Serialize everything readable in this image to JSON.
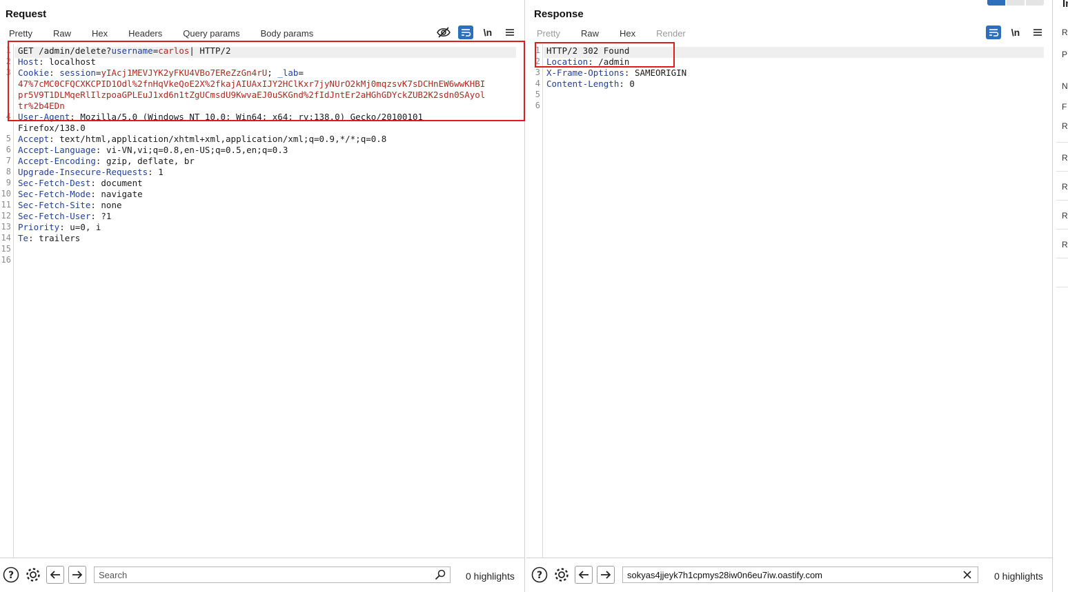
{
  "request": {
    "title": "Request",
    "tabs": [
      {
        "label": "Pretty",
        "active": true
      },
      {
        "label": "Raw"
      },
      {
        "label": "Hex"
      },
      {
        "label": "Headers"
      },
      {
        "label": "Query params"
      },
      {
        "label": "Body params"
      }
    ],
    "toolbar": {
      "newline_label": "\\n"
    },
    "lines": [
      {
        "n": "1",
        "seg": [
          [
            "GET /admin/delete?",
            ""
          ],
          [
            "username",
            "blue"
          ],
          [
            "=",
            ""
          ],
          [
            "carlos",
            "red"
          ],
          [
            "| HTTP/2",
            ""
          ]
        ]
      },
      {
        "n": "2",
        "seg": [
          [
            "Host",
            "blue"
          ],
          [
            ": localhost",
            ""
          ]
        ]
      },
      {
        "n": "3",
        "seg": [
          [
            "Cookie",
            "blue"
          ],
          [
            ": ",
            ""
          ],
          [
            "session",
            "blue"
          ],
          [
            "=",
            ""
          ],
          [
            "yIAcj1MEVJYK2yFKU4VBo7EReZzGn4rU",
            "red"
          ],
          [
            "; ",
            ""
          ],
          [
            "_lab",
            "blue"
          ],
          [
            "=",
            ""
          ]
        ]
      },
      {
        "n": "",
        "seg": [
          [
            "47%7cMC0CFQCXKCPID1Odl%2fnHqVkeQoE2X%2fkajAIUAxIJY2HClKxr7jyNUrO2kMj0mqzsvK7sDCHnEW6wwKHBI",
            "red"
          ]
        ]
      },
      {
        "n": "",
        "seg": [
          [
            "pr5V9T1DLMqeRlIlzpoaGPLEuJ1xd6n1tZgUCmsdU9KwvaEJ0uSKGnd%2fIdJntEr2aHGhGDYckZUB2K2sdn0SAyol",
            "red"
          ]
        ]
      },
      {
        "n": "",
        "seg": [
          [
            "tr%2b4EDn",
            "red"
          ]
        ]
      },
      {
        "n": "4",
        "seg": [
          [
            "User-Agent",
            "blue"
          ],
          [
            ": Mozilla/5.0 (Windows NT 10.0; Win64; x64; rv:138.0) Gecko/20100101",
            ""
          ]
        ]
      },
      {
        "n": "",
        "seg": [
          [
            "Firefox/138.0",
            ""
          ]
        ]
      },
      {
        "n": "5",
        "seg": [
          [
            "Accept",
            "blue"
          ],
          [
            ": text/html,application/xhtml+xml,application/xml;q=0.9,*/*;q=0.8",
            ""
          ]
        ]
      },
      {
        "n": "6",
        "seg": [
          [
            "Accept-Language",
            "blue"
          ],
          [
            ": vi-VN,vi;q=0.8,en-US;q=0.5,en;q=0.3",
            ""
          ]
        ]
      },
      {
        "n": "7",
        "seg": [
          [
            "Accept-Encoding",
            "blue"
          ],
          [
            ": gzip, deflate, br",
            ""
          ]
        ]
      },
      {
        "n": "8",
        "seg": [
          [
            "Upgrade-Insecure-Requests",
            "blue"
          ],
          [
            ": 1",
            ""
          ]
        ]
      },
      {
        "n": "9",
        "seg": [
          [
            "Sec-Fetch-Dest",
            "blue"
          ],
          [
            ": document",
            ""
          ]
        ]
      },
      {
        "n": "10",
        "seg": [
          [
            "Sec-Fetch-Mode",
            "blue"
          ],
          [
            ": navigate",
            ""
          ]
        ]
      },
      {
        "n": "11",
        "seg": [
          [
            "Sec-Fetch-Site",
            "blue"
          ],
          [
            ": none",
            ""
          ]
        ]
      },
      {
        "n": "12",
        "seg": [
          [
            "Sec-Fetch-User",
            "blue"
          ],
          [
            ": ?1",
            ""
          ]
        ]
      },
      {
        "n": "13",
        "seg": [
          [
            "Priority",
            "blue"
          ],
          [
            ": u=0, i",
            ""
          ]
        ]
      },
      {
        "n": "14",
        "seg": [
          [
            "Te",
            "blue"
          ],
          [
            ": trailers",
            ""
          ]
        ]
      },
      {
        "n": "15",
        "seg": []
      },
      {
        "n": "16",
        "seg": []
      }
    ],
    "search": {
      "placeholder": "Search",
      "value": ""
    },
    "highlights": "0 highlights"
  },
  "response": {
    "title": "Response",
    "tabs": [
      {
        "label": "Pretty",
        "disabled": true
      },
      {
        "label": "Raw"
      },
      {
        "label": "Hex"
      },
      {
        "label": "Render",
        "disabled": true
      }
    ],
    "toolbar": {
      "newline_label": "\\n"
    },
    "lines": [
      {
        "n": "1",
        "seg": [
          [
            "HTTP/2 302 Found",
            ""
          ]
        ]
      },
      {
        "n": "2",
        "seg": [
          [
            "Location",
            "blue"
          ],
          [
            ": /admin",
            ""
          ]
        ]
      },
      {
        "n": "3",
        "seg": [
          [
            "X-Frame-Options",
            "blue"
          ],
          [
            ": SAMEORIGIN",
            ""
          ]
        ]
      },
      {
        "n": "4",
        "seg": [
          [
            "Content-Length",
            "blue"
          ],
          [
            ": 0",
            ""
          ]
        ]
      },
      {
        "n": "5",
        "seg": []
      },
      {
        "n": "6",
        "seg": []
      }
    ],
    "search": {
      "placeholder": "",
      "value": "sokyas4jjeyk7h1cpmys28iw0n6eu7iw.oastify.com"
    },
    "highlights": "0 highlights"
  },
  "inspector": {
    "title": "In",
    "items": [
      "R",
      "P",
      "N",
      "F",
      "R",
      "R",
      "R",
      "R",
      "R"
    ]
  },
  "colors": {
    "accent": "#e8641b",
    "highlight_box": "#e01a1a",
    "header_name": "#1f3fa0",
    "value_red": "#b2261c",
    "active_button": "#2d6fbb"
  }
}
